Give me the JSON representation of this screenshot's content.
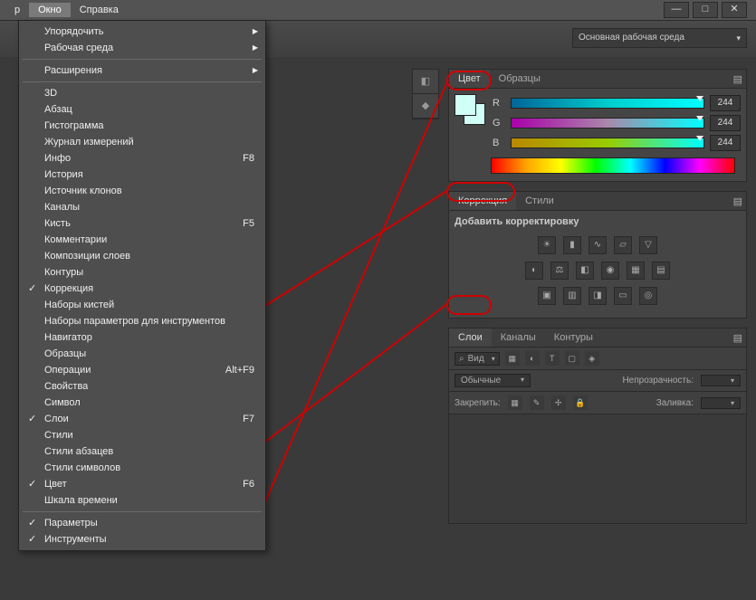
{
  "menubar": {
    "prev": "р",
    "window": "Окно",
    "help": "Справка"
  },
  "winbtns": {
    "min": "—",
    "max": "□",
    "close": "✕"
  },
  "workspace": "Основная рабочая среда",
  "dropdown": {
    "arrange": "Упорядочить",
    "workspace": "Рабочая среда",
    "extensions": "Расширения",
    "d3": "3D",
    "paragraph": "Абзац",
    "histogram": "Гистограмма",
    "measure": "Журнал измерений",
    "info": "Инфо",
    "info_sc": "F8",
    "history": "История",
    "clone": "Источник клонов",
    "channels": "Каналы",
    "brush": "Кисть",
    "brush_sc": "F5",
    "comments": "Комментарии",
    "layercomps": "Композиции слоев",
    "paths": "Контуры",
    "adjustments": "Коррекция",
    "brushsets": "Наборы кистей",
    "toolpresets": "Наборы параметров для инструментов",
    "navigator": "Навигатор",
    "swatches": "Образцы",
    "actions": "Операции",
    "actions_sc": "Alt+F9",
    "properties": "Свойства",
    "character": "Символ",
    "layers": "Слои",
    "layers_sc": "F7",
    "styles": "Стили",
    "parastyles": "Стили абзацев",
    "charstyles": "Стили символов",
    "color": "Цвет",
    "color_sc": "F6",
    "timeline": "Шкала времени",
    "options": "Параметры",
    "tools": "Инструменты"
  },
  "panel_color": {
    "tab1": "Цвет",
    "tab2": "Образцы",
    "r": "R",
    "g": "G",
    "b": "B",
    "val": "244"
  },
  "panel_adj": {
    "tab1": "Коррекция",
    "tab2": "Стили",
    "title": "Добавить корректировку"
  },
  "panel_layers": {
    "tab1": "Слои",
    "tab2": "Каналы",
    "tab3": "Контуры",
    "search": "Вид",
    "blend": "Обычные",
    "opacity": "Непрозрачность:",
    "lock": "Закрепить:",
    "fill": "Заливка:"
  }
}
